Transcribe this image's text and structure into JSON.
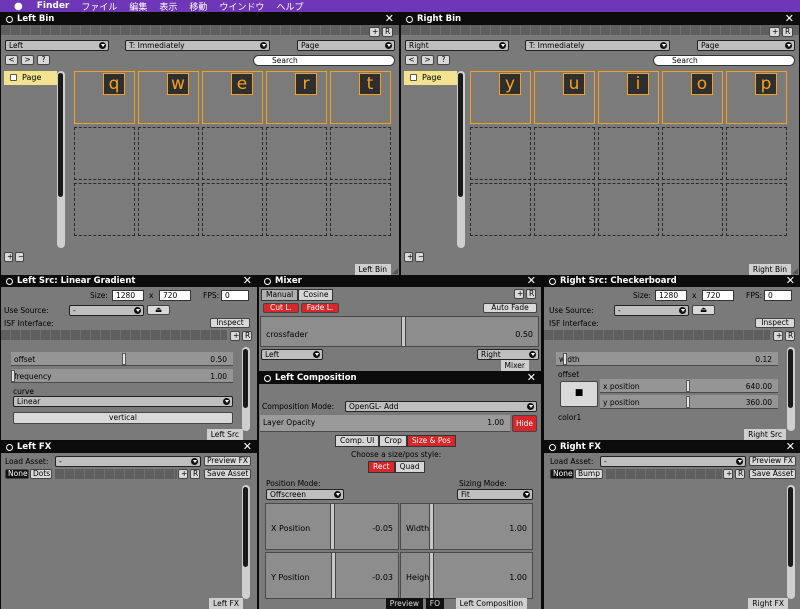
{
  "menubar": {
    "app": "Finder",
    "items": [
      "ファイル",
      "編集",
      "表示",
      "移動",
      "ウインドウ",
      "ヘルプ"
    ]
  },
  "left_bin": {
    "title": "Left Bin",
    "target": "Left",
    "trigger": "T: Immediately",
    "mode": "Page",
    "search": "Search",
    "page_item": "Page",
    "tiles": [
      "q",
      "w",
      "e",
      "r",
      "t"
    ],
    "tab": "Left Bin"
  },
  "right_bin": {
    "title": "Right Bin",
    "target": "Right",
    "trigger": "T: Immediately",
    "mode": "Page",
    "search": "Search",
    "page_item": "Page",
    "tiles": [
      "y",
      "u",
      "i",
      "o",
      "p"
    ],
    "tab": "Right Bin"
  },
  "left_src": {
    "title": "Left Src: Linear Gradient",
    "size_label": "Size:",
    "w": "1280",
    "x": "x",
    "h": "720",
    "fps_label": "FPS:",
    "fps": "0",
    "use_source": "Use Source:",
    "source": "-",
    "isf": "ISF Interface:",
    "inspect": "Inspect",
    "offset_label": "offset",
    "offset_value": "0.50",
    "offset_level": 0.5,
    "freq_label": "frequency",
    "freq_value": "1.00",
    "freq_level": 0,
    "curve_label": "curve",
    "curve_value": "Linear",
    "vertical": "vertical",
    "tab": "Left Src"
  },
  "mixer": {
    "title": "Mixer",
    "manual": "Manual",
    "cosine": "Cosine",
    "cut": "Cut L.",
    "fade": "Fade L.",
    "auto_fade": "Auto Fade",
    "crossfader_label": "crossfader",
    "crossfader_value": "0.50",
    "crossfader_level": 0.5,
    "left": "Left",
    "right": "Right",
    "tab": "Mixer"
  },
  "right_src": {
    "title": "Right Src: Checkerboard",
    "size_label": "Size:",
    "w": "1280",
    "x": "x",
    "h": "720",
    "fps_label": "FPS:",
    "fps": "0",
    "use_source": "Use Source:",
    "source": "-",
    "isf": "ISF Interface:",
    "inspect": "Inspect",
    "width_label": "width",
    "width_value": "0.12",
    "width_level": 0.03,
    "offset_label": "offset",
    "xpos_label": "x position",
    "xpos_value": "640.00",
    "ypos_label": "y position",
    "ypos_value": "360.00",
    "color_label": "color1",
    "tab": "Right Src"
  },
  "left_comp": {
    "title": "Left Composition",
    "mode_label": "Composition Mode:",
    "mode_value": "OpenGL- Add",
    "opacity_label": "Layer Opacity",
    "opacity_value": "1.00",
    "hide": "Hide",
    "tabs": [
      "Comp. UI",
      "Crop",
      "Size & Pos"
    ],
    "choose": "Choose a size/pos style:",
    "rect": "Rect",
    "quad": "Quad",
    "pos_mode_label": "Position Mode:",
    "pos_mode": "Offscreen",
    "sizing_label": "Sizing Mode:",
    "sizing": "Fit",
    "xpos_label": "X Position",
    "xpos_value": "-0.05",
    "width_label": "Width",
    "width_value": "1.00",
    "ypos_label": "Y Position",
    "ypos_value": "-0.03",
    "height_label": "Height",
    "height_value": "1.00",
    "bottom_tabs": [
      "Preview",
      "FO",
      "Left Composition"
    ]
  },
  "left_fx": {
    "title": "Left FX",
    "load_asset": "Load Asset:",
    "asset": "-",
    "preview": "Preview FX",
    "save": "Save Asset",
    "none": "None",
    "dots": "Dots",
    "tab": "Left FX"
  },
  "right_fx": {
    "title": "Right FX",
    "load_asset": "Load Asset:",
    "asset": "-",
    "preview": "Preview FX",
    "save": "Save Asset",
    "none": "None",
    "bump": "Bump",
    "tab": "Right FX"
  },
  "colors": {
    "menubar": "#6f37b7",
    "accent": "#f7a11a",
    "red": "#d8272b",
    "page_item": "#f3e38f"
  }
}
